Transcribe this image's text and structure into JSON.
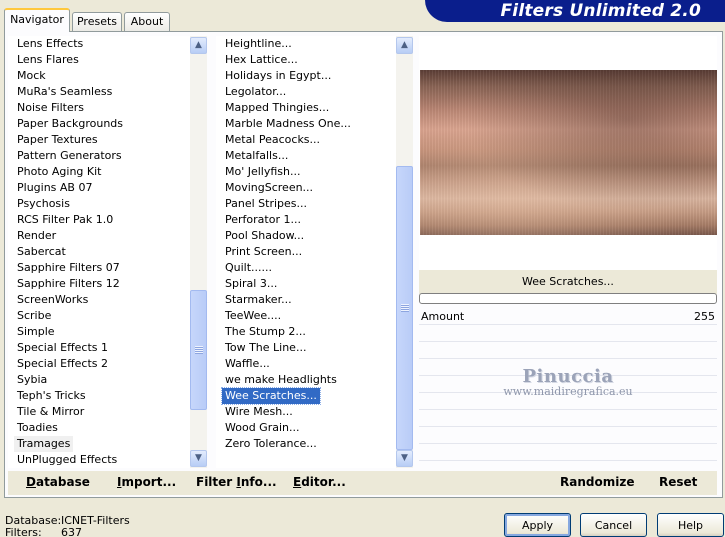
{
  "tabs": [
    {
      "label": "Navigator"
    },
    {
      "label": "Presets"
    },
    {
      "label": "About"
    }
  ],
  "banner": {
    "title": "Filters Unlimited 2.0"
  },
  "categories": {
    "items": [
      "Lens Effects",
      "Lens Flares",
      "Mock",
      "MuRa's Seamless",
      "Noise Filters",
      "Paper Backgrounds",
      "Paper Textures",
      "Pattern Generators",
      "Photo Aging Kit",
      "Plugins AB 07",
      "Psychosis",
      "RCS Filter Pak 1.0",
      "Render",
      "Sabercat",
      "Sapphire Filters 07",
      "Sapphire Filters 12",
      "ScreenWorks",
      "Scribe",
      "Simple",
      "Special Effects 1",
      "Special Effects 2",
      "Sybia",
      "Teph's Tricks",
      "Tile & Mirror",
      "Toadies",
      "Tramages",
      "UnPlugged Effects"
    ],
    "selected": "Tramages"
  },
  "filters": {
    "items": [
      "Heightline...",
      "Hex Lattice...",
      "Holidays in Egypt...",
      "Legolator...",
      "Mapped Thingies...",
      "Marble Madness One...",
      "Metal Peacocks...",
      "Metalfalls...",
      "Mo' Jellyfish...",
      "MovingScreen...",
      "Panel Stripes...",
      "Perforator 1...",
      "Pool Shadow...",
      "Print Screen...",
      "Quilt......",
      "Spiral 3...",
      "Starmaker...",
      "TeeWee....",
      "The Stump 2...",
      "Tow The Line...",
      "Waffle...",
      "we make Headlights",
      "Wee Scratches...",
      "Wire Mesh...",
      "Wood Grain...",
      "Zero Tolerance..."
    ],
    "selected": "Wee Scratches..."
  },
  "preview": {
    "filter_name": "Wee Scratches...",
    "progress": 0
  },
  "params": [
    {
      "label": "Amount",
      "value": "255"
    }
  ],
  "watermark": {
    "name": "Pinuccia",
    "url": "www.maidiregrafica.eu"
  },
  "actions": {
    "database_u": "D",
    "database_rest": "atabase",
    "import_u": "I",
    "import_rest": "mport...",
    "filterinfo_pre": "Filter ",
    "filterinfo_u": "I",
    "filterinfo_rest": "nfo...",
    "editor_u": "E",
    "editor_rest": "ditor...",
    "randomize": "Randomize",
    "reset": "Reset"
  },
  "status": {
    "db_label": "Database:",
    "db_value": "ICNET-Filters",
    "filters_label": "Filters:",
    "filters_value": "637"
  },
  "dialog": {
    "apply": "Apply",
    "cancel": "Cancel",
    "help": "Help"
  }
}
